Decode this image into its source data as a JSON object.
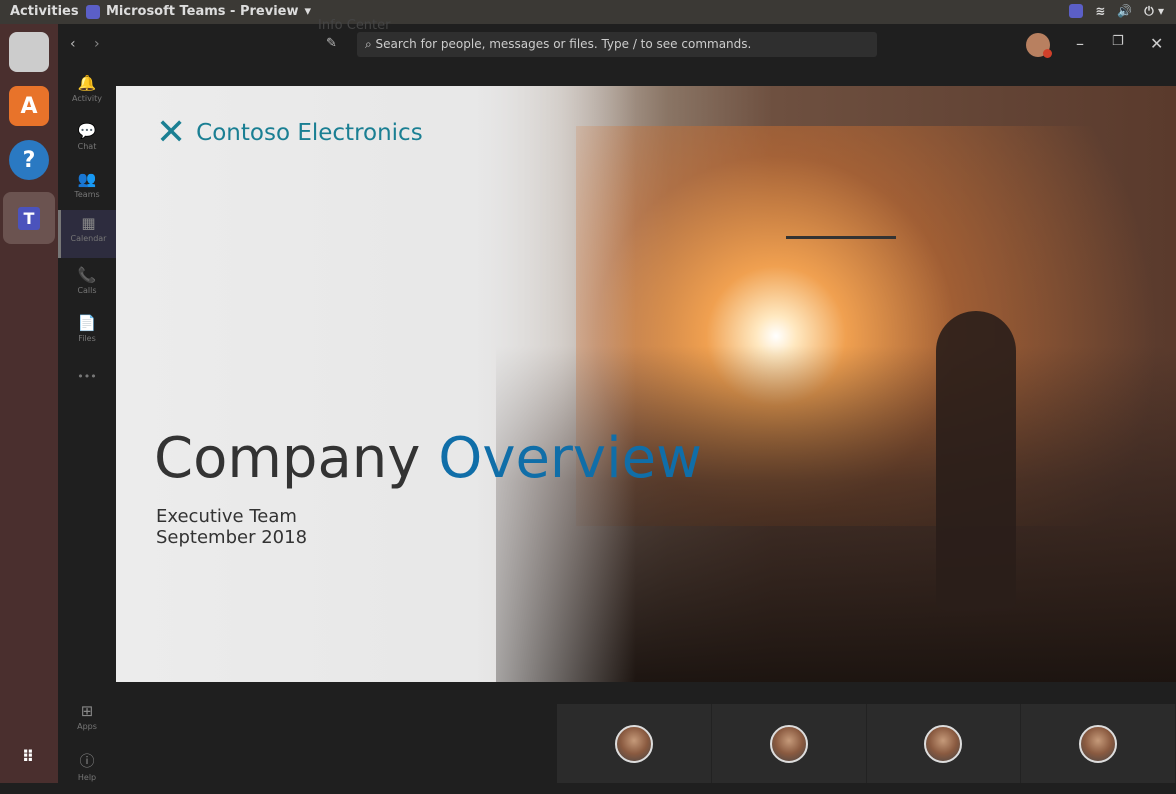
{
  "topbar": {
    "activities": "Activities",
    "app_title": "Microsoft Teams - Preview",
    "dropdown": "▾",
    "tray": [
      "wifi",
      "volume",
      "power"
    ]
  },
  "dock": {
    "items": [
      "files",
      "software",
      "help",
      "teams"
    ]
  },
  "ghost_text": "Info Center",
  "rail": {
    "items": [
      {
        "label": "Activity",
        "icon": "🔔"
      },
      {
        "label": "Chat",
        "icon": "💬"
      },
      {
        "label": "Teams",
        "icon": "👥"
      },
      {
        "label": "Calendar",
        "icon": "▦"
      },
      {
        "label": "Calls",
        "icon": "📞"
      },
      {
        "label": "Files",
        "icon": "📄"
      }
    ],
    "more": "•••",
    "apps": "Apps",
    "help": "Help"
  },
  "search": {
    "placeholder": "Search for people, messages or files. Type / to see commands."
  },
  "slide": {
    "brand": "Contoso Electronics",
    "title_1": "Company",
    "title_2": "Overview",
    "subtitle_1": "Executive Team",
    "subtitle_2": "September 2018"
  },
  "participants": 4
}
